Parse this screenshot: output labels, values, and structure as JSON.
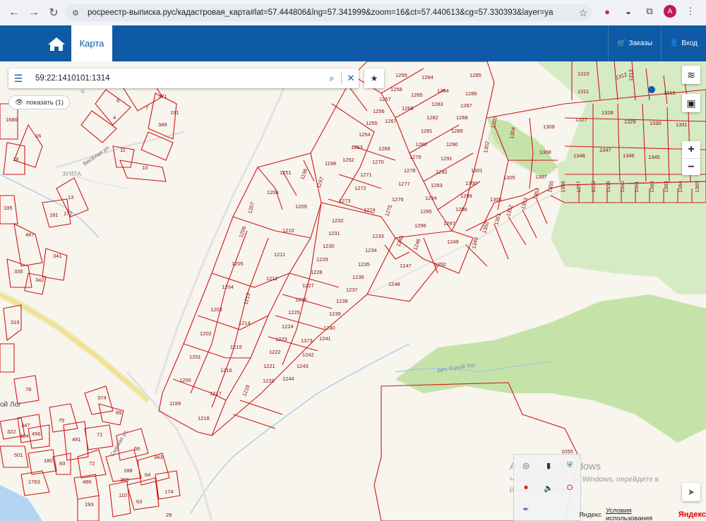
{
  "browser": {
    "url": "росреестр-выписка.рус/кадастровая_карта#lat=57.444806&lng=57.341999&zoom=16&ct=57.440613&cg=57.330393&layer=ya",
    "profile_initial": "A"
  },
  "header": {
    "tab_map": "Карта",
    "orders_label": "Заказы",
    "login_label": "Вход",
    "brand_color": "#0e5aa7"
  },
  "search": {
    "value": "59:22:1410101:1314",
    "show_label": "показать (1)"
  },
  "map": {
    "place_labels": [
      "ЗУЯТА",
      "Весёлая ул.",
      "ой Лог",
      "руч. Сухой Лог",
      "Садовая ул.",
      "р. Таз"
    ],
    "parcels": [
      {
        "n": "1310"
      },
      {
        "n": "1311"
      },
      {
        "n": "1312"
      },
      {
        "n": "1313"
      },
      {
        "n": "1315"
      },
      {
        "n": "1327"
      },
      {
        "n": "1328"
      },
      {
        "n": "1329"
      },
      {
        "n": "1330"
      },
      {
        "n": "1331"
      },
      {
        "n": "1348"
      },
      {
        "n": "1347"
      },
      {
        "n": "1346"
      },
      {
        "n": "1345"
      },
      {
        "n": "1309"
      },
      {
        "n": "1308"
      },
      {
        "n": "1307"
      },
      {
        "n": "1305"
      },
      {
        "n": "1304"
      },
      {
        "n": "1303"
      },
      {
        "n": "1302"
      },
      {
        "n": "1301"
      },
      {
        "n": "1300"
      },
      {
        "n": "1299"
      },
      {
        "n": "1298"
      },
      {
        "n": "1297"
      },
      {
        "n": "1296"
      },
      {
        "n": "1295"
      },
      {
        "n": "1294"
      },
      {
        "n": "1293"
      },
      {
        "n": "1292"
      },
      {
        "n": "1291"
      },
      {
        "n": "1290"
      },
      {
        "n": "1289"
      },
      {
        "n": "1288"
      },
      {
        "n": "1287"
      },
      {
        "n": "1286"
      },
      {
        "n": "1285"
      },
      {
        "n": "1284"
      },
      {
        "n": "1283"
      },
      {
        "n": "1282"
      },
      {
        "n": "1281"
      },
      {
        "n": "1280"
      },
      {
        "n": "1279"
      },
      {
        "n": "1278"
      },
      {
        "n": "1277"
      },
      {
        "n": "1276"
      },
      {
        "n": "1275"
      },
      {
        "n": "1274"
      },
      {
        "n": "1273"
      },
      {
        "n": "1272"
      },
      {
        "n": "1271"
      },
      {
        "n": "1270"
      },
      {
        "n": "1269"
      },
      {
        "n": "1267"
      },
      {
        "n": "1266"
      },
      {
        "n": "1265"
      },
      {
        "n": "1264"
      },
      {
        "n": "1259"
      },
      {
        "n": "1258"
      },
      {
        "n": "1257"
      },
      {
        "n": "1256"
      },
      {
        "n": "1255"
      },
      {
        "n": "1254"
      },
      {
        "n": "1253"
      },
      {
        "n": "1252"
      },
      {
        "n": "1251"
      },
      {
        "n": "1250"
      },
      {
        "n": "1249"
      },
      {
        "n": "1248"
      },
      {
        "n": "1247"
      },
      {
        "n": "1246"
      },
      {
        "n": "1245"
      },
      {
        "n": "1244"
      },
      {
        "n": "1243"
      },
      {
        "n": "1242"
      },
      {
        "n": "1241"
      },
      {
        "n": "1240"
      },
      {
        "n": "1239"
      },
      {
        "n": "1238"
      },
      {
        "n": "1237"
      },
      {
        "n": "1236"
      },
      {
        "n": "1235"
      },
      {
        "n": "1234"
      },
      {
        "n": "1233"
      },
      {
        "n": "1232"
      },
      {
        "n": "1231"
      },
      {
        "n": "1230"
      },
      {
        "n": "1229"
      },
      {
        "n": "1228"
      },
      {
        "n": "1227"
      },
      {
        "n": "1226"
      },
      {
        "n": "1225"
      },
      {
        "n": "1224"
      },
      {
        "n": "1223"
      },
      {
        "n": "1222"
      },
      {
        "n": "1221"
      },
      {
        "n": "1220"
      },
      {
        "n": "1219"
      },
      {
        "n": "1218"
      },
      {
        "n": "1217"
      },
      {
        "n": "1216"
      },
      {
        "n": "1215"
      },
      {
        "n": "1214"
      },
      {
        "n": "1213"
      },
      {
        "n": "1212"
      },
      {
        "n": "1211"
      },
      {
        "n": "1210"
      },
      {
        "n": "1209"
      },
      {
        "n": "1208"
      },
      {
        "n": "1207"
      },
      {
        "n": "1206"
      },
      {
        "n": "1205"
      },
      {
        "n": "1204"
      },
      {
        "n": "1203"
      },
      {
        "n": "1202"
      },
      {
        "n": "1201"
      },
      {
        "n": "1200"
      },
      {
        "n": "1199"
      },
      {
        "n": "1198"
      },
      {
        "n": "1197"
      },
      {
        "n": "1196"
      },
      {
        "n": "1373"
      },
      {
        "n": "1349"
      },
      {
        "n": "1350"
      },
      {
        "n": "1351"
      },
      {
        "n": "1352"
      },
      {
        "n": "1353"
      },
      {
        "n": "1354"
      },
      {
        "n": "1355"
      },
      {
        "n": "1356"
      },
      {
        "n": "1357"
      },
      {
        "n": "1358"
      },
      {
        "n": "1359"
      },
      {
        "n": "1360"
      },
      {
        "n": "1361"
      },
      {
        "n": "1362"
      },
      {
        "n": "1363"
      },
      {
        "n": "1364"
      },
      {
        "n": "1365"
      },
      {
        "n": "1306"
      },
      {
        "n": "1055"
      },
      {
        "n": "371"
      },
      {
        "n": "6"
      },
      {
        "n": "7"
      },
      {
        "n": "191"
      },
      {
        "n": "349"
      },
      {
        "n": "4"
      },
      {
        "n": "16"
      },
      {
        "n": "18"
      },
      {
        "n": "1680"
      },
      {
        "n": "11"
      },
      {
        "n": "10"
      },
      {
        "n": "13"
      },
      {
        "n": "177"
      },
      {
        "n": "181"
      },
      {
        "n": "195"
      },
      {
        "n": "497"
      },
      {
        "n": "341"
      },
      {
        "n": "335"
      },
      {
        "n": "342"
      },
      {
        "n": "319"
      },
      {
        "n": "78"
      },
      {
        "n": "374"
      },
      {
        "n": "69"
      },
      {
        "n": "75"
      },
      {
        "n": "322"
      },
      {
        "n": "347"
      },
      {
        "n": "184"
      },
      {
        "n": "496"
      },
      {
        "n": "491"
      },
      {
        "n": "71"
      },
      {
        "n": "501"
      },
      {
        "n": "180"
      },
      {
        "n": "83"
      },
      {
        "n": "72"
      },
      {
        "n": "66"
      },
      {
        "n": "343"
      },
      {
        "n": "188"
      },
      {
        "n": "369"
      },
      {
        "n": "64"
      },
      {
        "n": "1763"
      },
      {
        "n": "486"
      },
      {
        "n": "174"
      },
      {
        "n": "110"
      },
      {
        "n": "63"
      },
      {
        "n": "193"
      },
      {
        "n": "29"
      }
    ]
  },
  "windows_activation": {
    "title": "Активация Windows",
    "line1": "Чтобы активировать Windows, перейдите в",
    "line2": "раздел \"Параметры\"."
  },
  "footer": {
    "copyright": "Яндекс",
    "terms_link": "Условия использования",
    "brand": "Яндекс"
  }
}
